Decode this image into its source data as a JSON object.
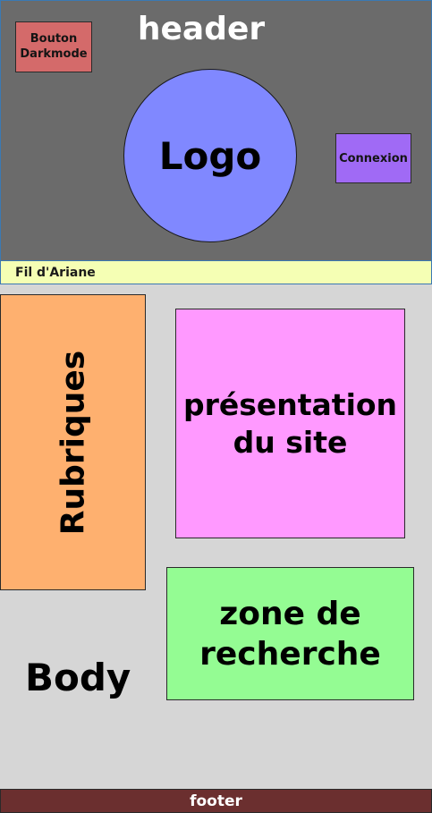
{
  "header": {
    "title": "header",
    "darkmode_button": "Bouton\nDarkmode",
    "logo": "Logo",
    "login_button": "Connexion"
  },
  "breadcrumb": {
    "label": "Fil d'Ariane"
  },
  "body": {
    "label": "Body",
    "rubriques": "Rubriques",
    "presentation": "présentation\ndu site",
    "search_zone": "zone de\nrecherche"
  },
  "footer": {
    "label": "footer"
  },
  "colors": {
    "header_bg": "#6b6b6b",
    "darkmode_button": "#d46a6a",
    "logo": "#8088ff",
    "login_button": "#a06af5",
    "breadcrumb_bg": "#f5ffb4",
    "body_bg": "#d6d6d6",
    "rubriques_bg": "#feb06f",
    "presentation_bg": "#ff99ff",
    "search_zone_bg": "#94fc93",
    "footer_bg": "#6b2f2f"
  }
}
